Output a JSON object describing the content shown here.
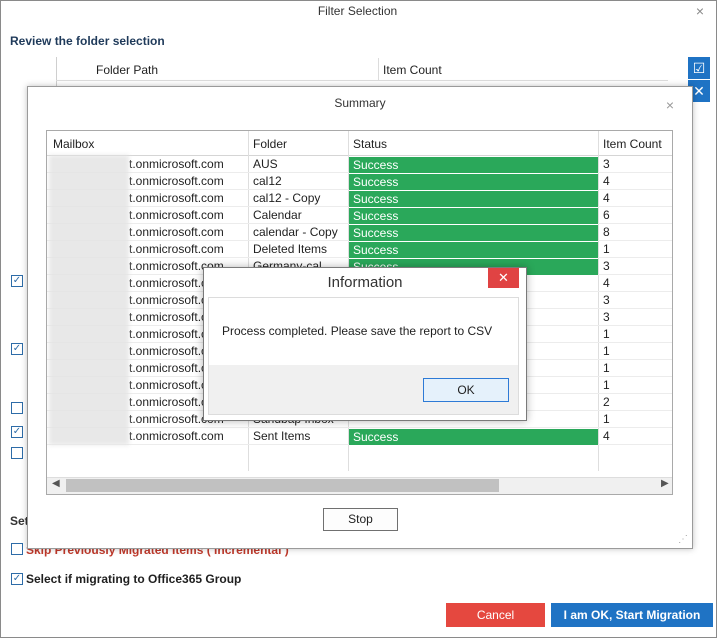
{
  "window": {
    "title": "Filter Selection",
    "close": "×"
  },
  "review_label": "Review the folder selection",
  "folder_table": {
    "col_path": "Folder Path",
    "col_count": "Item Count"
  },
  "side_icons": {
    "check": "☑",
    "close": "✕"
  },
  "settings_label": "Set",
  "skip_label": "Skip Previously Migrated Items ( Incremental )",
  "group_label": "Select if migrating to Office365 Group",
  "buttons": {
    "cancel": "Cancel",
    "start": "I am OK, Start Migration"
  },
  "summary": {
    "title": "Summary",
    "close": "×",
    "columns": [
      "Mailbox",
      "Folder",
      "Status",
      "Item Count"
    ],
    "rows": [
      {
        "mailbox": "t.onmicrosoft.com",
        "folder": "AUS",
        "status": "Success",
        "count": "3"
      },
      {
        "mailbox": "t.onmicrosoft.com",
        "folder": "cal12",
        "status": "Success",
        "count": "4"
      },
      {
        "mailbox": "t.onmicrosoft.com",
        "folder": "cal12 - Copy",
        "status": "Success",
        "count": "4"
      },
      {
        "mailbox": "t.onmicrosoft.com",
        "folder": "Calendar",
        "status": "Success",
        "count": "6"
      },
      {
        "mailbox": "t.onmicrosoft.com",
        "folder": "calendar - Copy",
        "status": "Success",
        "count": "8"
      },
      {
        "mailbox": "t.onmicrosoft.com",
        "folder": "Deleted Items",
        "status": "Success",
        "count": "1"
      },
      {
        "mailbox": "t.onmicrosoft.com",
        "folder": "Germany-cal",
        "status": "Success",
        "count": "3"
      },
      {
        "mailbox": "t.onmicrosoft.com",
        "folder": "",
        "status": "",
        "count": "4"
      },
      {
        "mailbox": "t.onmicrosoft.com",
        "folder": "",
        "status": "",
        "count": "3"
      },
      {
        "mailbox": "t.onmicrosoft.com",
        "folder": "",
        "status": "",
        "count": "3"
      },
      {
        "mailbox": "t.onmicrosoft.com",
        "folder": "",
        "status": "",
        "count": "1"
      },
      {
        "mailbox": "t.onmicrosoft.com",
        "folder": "",
        "status": "",
        "count": "1"
      },
      {
        "mailbox": "t.onmicrosoft.com",
        "folder": "",
        "status": "",
        "count": "1"
      },
      {
        "mailbox": "t.onmicrosoft.com",
        "folder": "",
        "status": "",
        "count": "1"
      },
      {
        "mailbox": "t.onmicrosoft.com",
        "folder": "",
        "status": "",
        "count": "2"
      },
      {
        "mailbox": "t.onmicrosoft.com",
        "folder": "Sandbap Inbox",
        "status": "",
        "count": "1"
      },
      {
        "mailbox": "t.onmicrosoft.com",
        "folder": "Sent Items",
        "status": "Success",
        "count": "4"
      }
    ],
    "stop": "Stop"
  },
  "info": {
    "title": "Information",
    "close": "✕",
    "message": "Process completed. Please save the report to CSV",
    "ok": "OK"
  },
  "colors": {
    "success": "#2aa85a",
    "primary": "#1f73c4",
    "danger": "#e5483f"
  }
}
